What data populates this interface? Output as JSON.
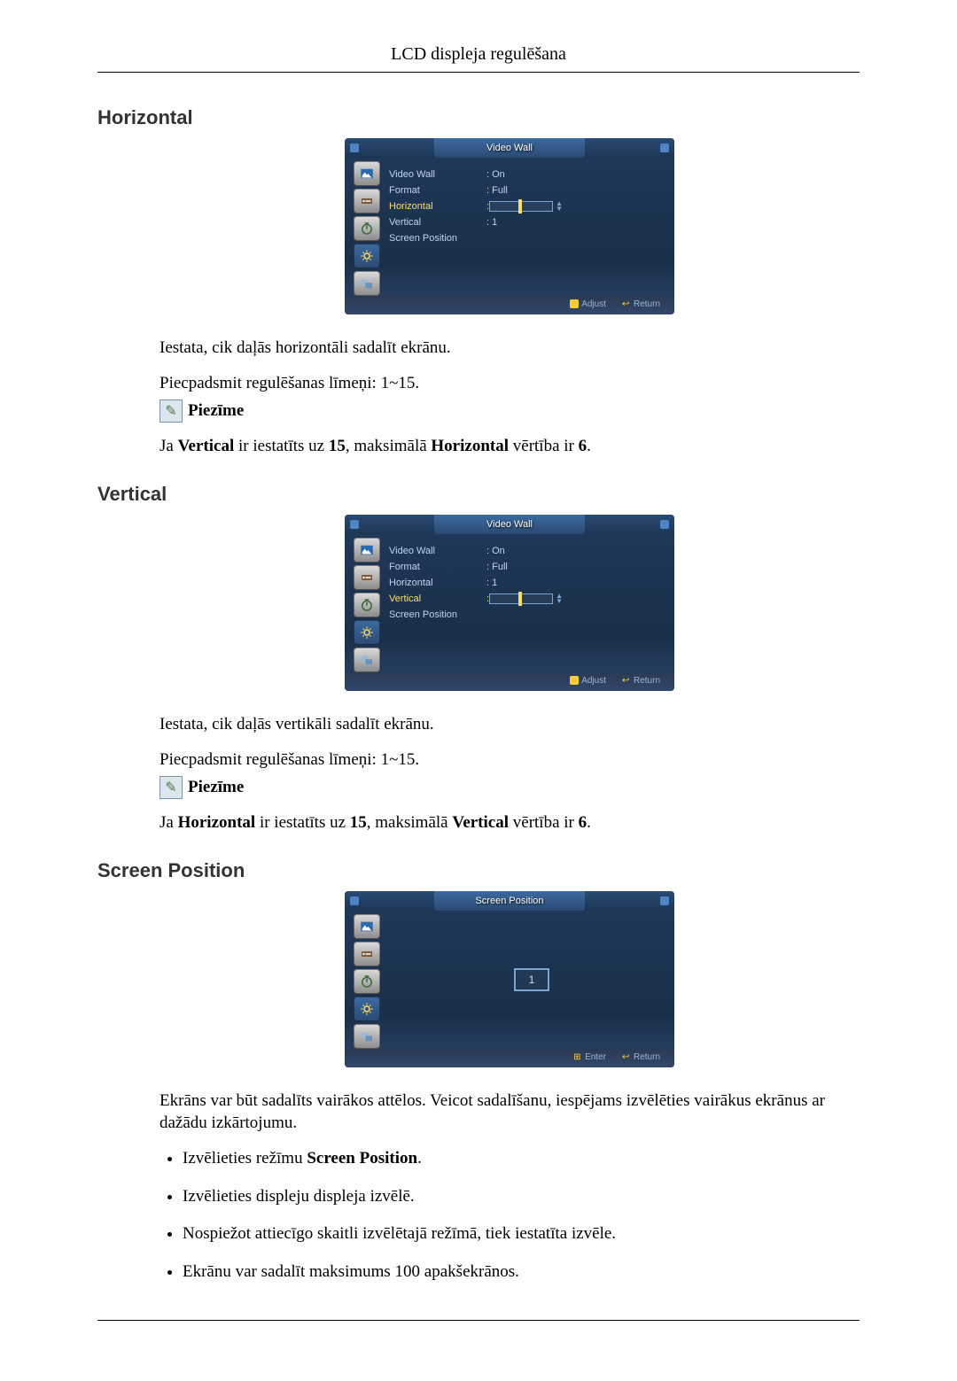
{
  "header": {
    "page_title": "LCD displeja regulēšana"
  },
  "sections": {
    "horizontal": {
      "heading": "Horizontal",
      "desc": "Iestata, cik daļās horizontāli sadalīt ekrānu.",
      "levels": "Piecpadsmit regulēšanas līmeņi: 1~15.",
      "note_label": "Piezīme",
      "note_text_pre": "Ja ",
      "note_text_b1": "Vertical",
      "note_text_mid": " ir iestatīts uz ",
      "note_text_b2": "15",
      "note_text_mid2": ", maksimālā ",
      "note_text_b3": "Horizontal",
      "note_text_post": " vērtība ir ",
      "note_text_b4": "6",
      "note_text_end": "."
    },
    "vertical": {
      "heading": "Vertical",
      "desc": "Iestata, cik daļās vertikāli sadalīt ekrānu.",
      "levels": "Piecpadsmit regulēšanas līmeņi: 1~15.",
      "note_label": "Piezīme",
      "note_text_pre": "Ja ",
      "note_text_b1": "Horizontal",
      "note_text_mid": " ir iestatīts uz ",
      "note_text_b2": "15",
      "note_text_mid2": ", maksimālā ",
      "note_text_b3": "Vertical",
      "note_text_post": " vērtība ir ",
      "note_text_b4": "6",
      "note_text_end": "."
    },
    "screen_position": {
      "heading": "Screen Position",
      "desc": "Ekrāns var būt sadalīts vairākos attēlos. Veicot sadalīšanu, iespējams izvēlēties vairākus ekrānus ar dažādu izkārtojumu.",
      "bullet1_pre": "Izvēlieties režīmu ",
      "bullet1_b": "Screen Position",
      "bullet1_post": ".",
      "bullet2": "Izvēlieties displeju displeja izvēlē.",
      "bullet3": "Nospiežot attiecīgo skaitli izvēlētajā režīmā, tiek iestatīta izvēle.",
      "bullet4": "Ekrānu var sadalīt maksimums 100 apakšekrānos."
    }
  },
  "osd_common": {
    "title_video_wall": "Video Wall",
    "title_screen_position": "Screen Position",
    "rows": {
      "video_wall": "Video Wall",
      "format": "Format",
      "horizontal": "Horizontal",
      "vertical": "Vertical",
      "screen_position": "Screen Position"
    },
    "values": {
      "on": ": On",
      "full": ": Full",
      "one": ": 1",
      "colon": ":"
    },
    "sp_value": "1",
    "footer": {
      "adjust": "Adjust",
      "return": "Return",
      "enter": "Enter"
    }
  }
}
